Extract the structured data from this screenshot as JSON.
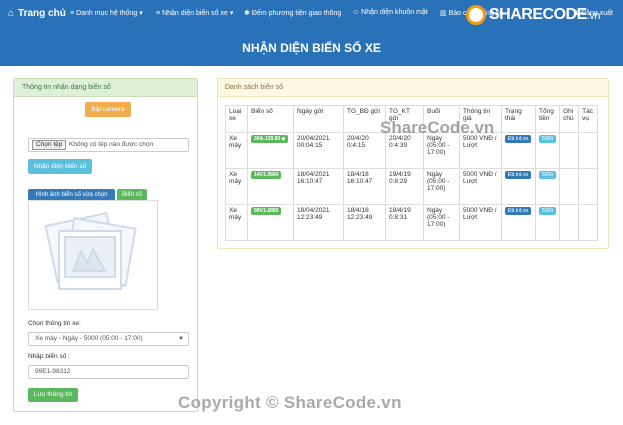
{
  "navbar": {
    "brand": "Trang chủ",
    "items": [
      {
        "label": "Danh mục hệ thống",
        "icon": "list-icon",
        "dropdown": true
      },
      {
        "label": "Nhận diện biển số xe",
        "icon": "list-icon",
        "dropdown": true
      },
      {
        "label": "Đếm phương tiện giao thông",
        "icon": "gear-icon",
        "dropdown": false
      },
      {
        "label": "Nhận diện khuôn mặt",
        "icon": "face-icon",
        "dropdown": false
      },
      {
        "label": "Báo cáo thống kê",
        "icon": "chart-icon",
        "dropdown": false
      }
    ],
    "logout": "Đăng xuất",
    "logo_text": "SHARECODE",
    "logo_suffix": ".vn"
  },
  "banner": {
    "title": "NHẬN DIỆN BIỂN SỐ XE"
  },
  "left": {
    "title": "Thông tin nhận dạng biển số",
    "camera_button": "Bật camera",
    "file_button": "Chọn tệp",
    "file_status": "Không có tệp nào được chọn",
    "detect_button": "Nhận diện biển số",
    "image_button": "Hình ảnh biển số vừa chọn",
    "plate_button": "Biển số",
    "select_label": "Chọn thông tin xe:",
    "select_value": "Xe máy - Ngày - 5000 (05:00 - 17:00)",
    "input_label": "Nhập biển số :",
    "input_value": "99E1-98312",
    "save_button": "Lưu thông tin"
  },
  "right": {
    "title": "Danh sách biển số",
    "columns": [
      "Loại xe",
      "Biển số",
      "Ngày gửi",
      "TG_BĐ gửi",
      "TG_KT gửi",
      "Buổi",
      "Thông tin giá",
      "Trạng thái",
      "Tổng tiền",
      "Ghi chú",
      "Tác vụ"
    ],
    "rows": [
      {
        "type": "Xe máy",
        "plate": "30A-128.83 ◆",
        "date": "20/04/2021 00:04:15",
        "start": "20/4/20 0:4:15",
        "end": "20/4/20 0:4:39",
        "session": "Ngày (05:00 - 17:00)",
        "price": "5000 VNĐ / Lượt",
        "status": "Đã trả xe",
        "total": "5000"
      },
      {
        "type": "Xe máy",
        "plate": "14V1-2890",
        "date": "18/04/2021 16:10:47",
        "start": "18/4/18 16:10:47",
        "end": "19/4/19 0:8:29",
        "session": "Ngày (05:00 - 17:00)",
        "price": "5000 VNĐ / Lượt",
        "status": "Đã trả xe",
        "total": "5000"
      },
      {
        "type": "Xe máy",
        "plate": "99V1-2880",
        "date": "18/04/2021 12:23:49",
        "start": "18/4/18 12:23:49",
        "end": "19/4/19 0:8:31",
        "session": "Ngày (05:00 - 17:00)",
        "price": "5000 VNĐ / Lượt",
        "status": "Đã trả xe",
        "total": "5000"
      }
    ]
  },
  "watermarks": {
    "center": "ShareCode.vn",
    "bottom": "Copyright © ShareCode.vn"
  }
}
